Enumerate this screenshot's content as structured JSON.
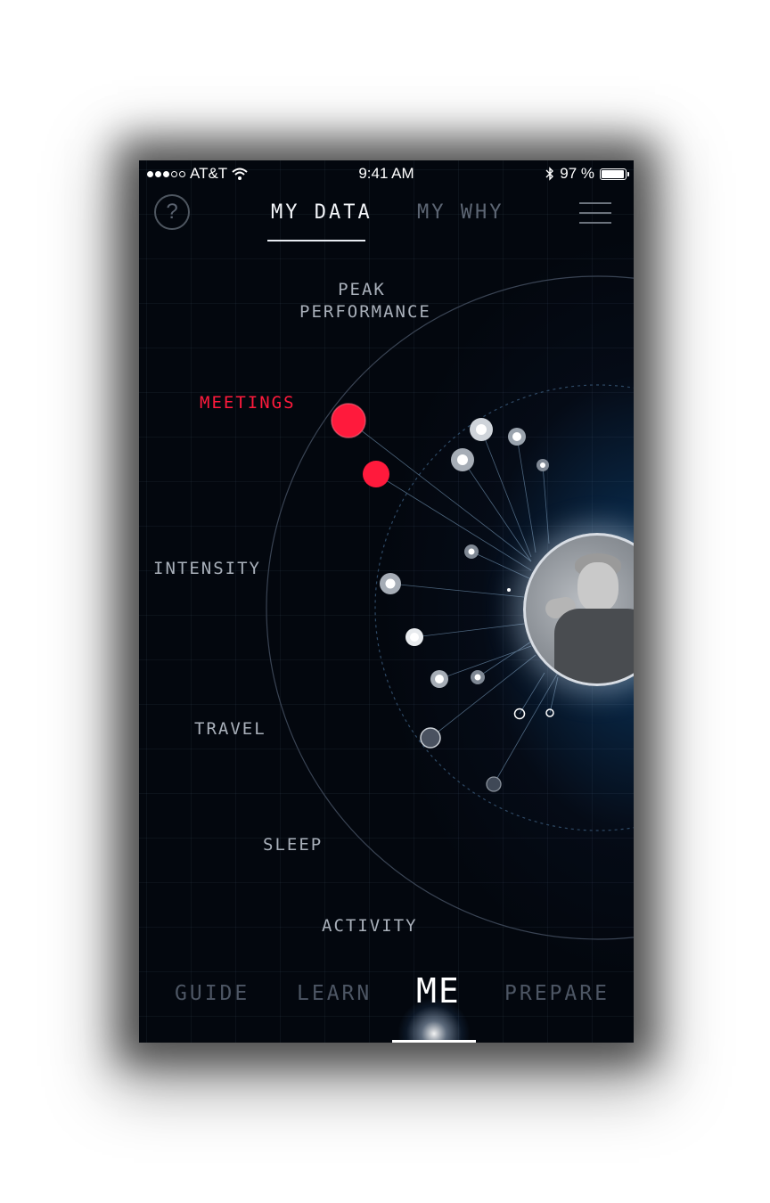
{
  "status_bar": {
    "carrier": "AT&T",
    "signal_strength": 3,
    "signal_max": 5,
    "time": "9:41 AM",
    "battery_percent": "97 %",
    "battery_level": 0.97,
    "icons": [
      "wifi-icon",
      "bluetooth-icon",
      "battery-icon"
    ]
  },
  "header": {
    "help_label": "?",
    "tabs": [
      {
        "label": "MY DATA",
        "active": true
      },
      {
        "label": "MY WHY",
        "active": false
      }
    ],
    "menu_icon": "hamburger-menu-icon"
  },
  "categories": {
    "peak_performance": "PEAK\nPERFORMANCE",
    "meetings": "MEETINGS",
    "intensity": "INTENSITY",
    "travel": "TRAVEL",
    "sleep": "SLEEP",
    "activity": "ACTIVITY"
  },
  "highlight_category": "MEETINGS",
  "profile_photo": "child-portrait",
  "bottom_nav": {
    "items": [
      {
        "label": "GUIDE",
        "active": false
      },
      {
        "label": "LEARN",
        "active": false
      },
      {
        "label": "ME",
        "active": true
      },
      {
        "label": "PREPARE",
        "active": false
      }
    ]
  },
  "colors": {
    "accent_red": "#ff1a3c",
    "background": "#03070e",
    "glow_blue": "#0d3456",
    "inactive_text": "#5d6674"
  }
}
